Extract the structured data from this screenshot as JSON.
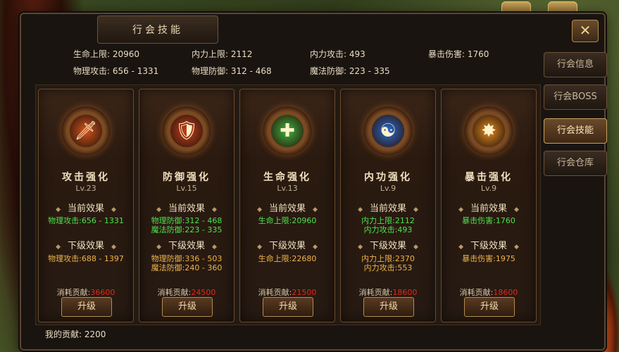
{
  "window": {
    "title": "行会技能",
    "close_icon": "close-icon"
  },
  "stats": [
    {
      "label": "生命上限:",
      "value": "20960"
    },
    {
      "label": "内力上限:",
      "value": "2112"
    },
    {
      "label": "内力攻击:",
      "value": "493"
    },
    {
      "label": "暴击伤害:",
      "value": "1760"
    },
    {
      "label": "物理攻击:",
      "value": "656 - 1331"
    },
    {
      "label": "物理防御:",
      "value": "312 - 468"
    },
    {
      "label": "魔法防御:",
      "value": "223 - 335"
    }
  ],
  "side_tabs": [
    {
      "label": "行会信息",
      "active": false
    },
    {
      "label": "行会BOSS",
      "active": false
    },
    {
      "label": "行会技能",
      "active": true
    },
    {
      "label": "行会仓库",
      "active": false
    }
  ],
  "current_label": "当前效果",
  "next_label": "下级效果",
  "cost_label": "消耗贡献:",
  "upgrade_label": "升级",
  "cards": [
    {
      "title": "攻击强化",
      "level": "Lv.23",
      "icon": "flaming-sword-icon",
      "icon_color": "#d4541c",
      "current": [
        "物理攻击:656 - 1331"
      ],
      "next": [
        "物理攻击:688 - 1397"
      ],
      "cost": "36600"
    },
    {
      "title": "防御强化",
      "level": "Lv.15",
      "icon": "shield-icon",
      "icon_color": "#c8401a",
      "current": [
        "物理防御:312 - 468",
        "魔法防御:223 - 335"
      ],
      "next": [
        "物理防御:336 - 503",
        "魔法防御:240 - 360"
      ],
      "cost": "24500"
    },
    {
      "title": "生命强化",
      "level": "Lv.13",
      "icon": "health-cross-icon",
      "icon_color": "#3eb43e",
      "current": [
        "生命上限:20960"
      ],
      "next": [
        "生命上限:22680"
      ],
      "cost": "21500"
    },
    {
      "title": "内功强化",
      "level": "Lv.9",
      "icon": "meditating-figure-icon",
      "icon_color": "#2a6ad0",
      "current": [
        "内力上限:2112",
        "内力攻击:493"
      ],
      "next": [
        "内力上限:2370",
        "内力攻击:553"
      ],
      "cost": "18600"
    },
    {
      "title": "暴击强化",
      "level": "Lv.9",
      "icon": "explosion-icon",
      "icon_color": "#e08a22",
      "current": [
        "暴击伤害:1760"
      ],
      "next": [
        "暴击伤害:1975"
      ],
      "cost": "18600"
    }
  ],
  "contribution": {
    "label": "我的贡献:",
    "value": "2200"
  }
}
